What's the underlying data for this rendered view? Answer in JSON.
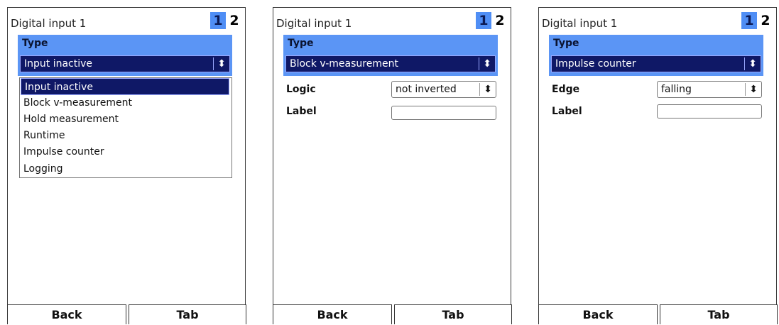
{
  "screens": [
    {
      "header_title": "Digital input 1",
      "tabs": [
        "1",
        "2"
      ],
      "type_label": "Type",
      "type_value": "Input inactive",
      "dropdown_options": [
        "Input inactive",
        "Block v-measurement",
        "Hold measurement",
        "Runtime",
        "Impulse counter",
        "Logging"
      ],
      "buttons": {
        "back": "Back",
        "tab": "Tab"
      }
    },
    {
      "header_title": "Digital input 1",
      "tabs": [
        "1",
        "2"
      ],
      "type_label": "Type",
      "type_value": "Block v-measurement",
      "field1_label": "Logic",
      "field1_value": "not inverted",
      "field2_label": "Label",
      "field2_value": "",
      "buttons": {
        "back": "Back",
        "tab": "Tab"
      }
    },
    {
      "header_title": "Digital input 1",
      "tabs": [
        "1",
        "2"
      ],
      "type_label": "Type",
      "type_value": "Impulse counter",
      "field1_label": "Edge",
      "field1_value": "falling",
      "field2_label": "Label",
      "field2_value": "",
      "buttons": {
        "back": "Back",
        "tab": "Tab"
      }
    }
  ],
  "icons": {
    "select_arrows": "⬍"
  },
  "colors": {
    "accent": "#5b95f5",
    "selection": "#0f1866",
    "tab_active": "#4f8ef5"
  }
}
